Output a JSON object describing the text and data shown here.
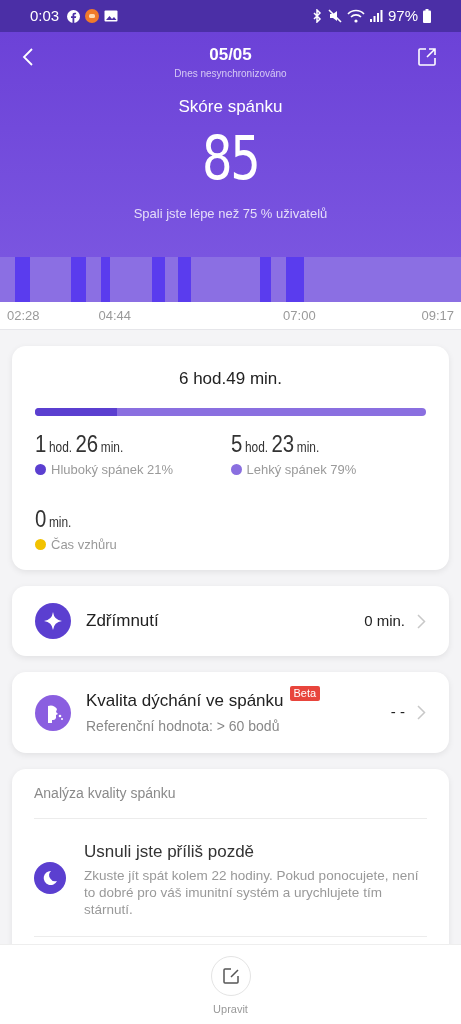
{
  "status_bar": {
    "time": "0:03",
    "battery": "97%"
  },
  "header": {
    "date": "05/05",
    "subtitle": "Dnes nesynchronizováno",
    "score_label": "Skóre spánku",
    "score": "85",
    "comparison": "Spali jste lépe než 75 % uživatelů"
  },
  "timeline": {
    "time_labels": [
      "02:28",
      "04:44",
      "07:00",
      "09:17"
    ]
  },
  "summary": {
    "total": "6 hod.49 min.",
    "level": 0.21,
    "stages": [
      {
        "parts": [
          {
            "num": "1",
            "unit": "hod."
          },
          {
            "num": "26",
            "unit": "min."
          }
        ],
        "label": "Hluboký spánek 21%",
        "color": "#5b3fd0"
      },
      {
        "parts": [
          {
            "num": "5",
            "unit": "hod."
          },
          {
            "num": "23",
            "unit": "min."
          }
        ],
        "label": "Lehký spánek 79%",
        "color": "#8a6fe0"
      },
      {
        "parts": [
          {
            "num": "0",
            "unit": "min."
          }
        ],
        "label": "Čas vzhůru",
        "color": "#f2c200"
      }
    ]
  },
  "rows": [
    {
      "kind": "nap",
      "title": "Zdřímnutí",
      "value": "0 min."
    },
    {
      "kind": "breathing",
      "title": "Kvalita dýchání ve spánku",
      "badge": "Beta",
      "subtitle": "Referenční hodnota: > 60 bodů",
      "value": "- -"
    }
  ],
  "analysis": {
    "title": "Analýza kvality spánku",
    "items": [
      {
        "title": "Usnuli jste příliš pozdě",
        "text": "Zkuste jít spát kolem 22 hodiny. Pokud ponocujete, není to dobré pro váš imunitní systém a urychlujete tím stárnutí."
      }
    ]
  },
  "bottom": {
    "button_label": "Upravit"
  }
}
